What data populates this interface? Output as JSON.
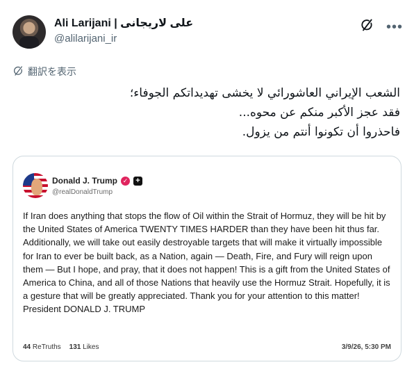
{
  "post": {
    "display_name": "Ali Larijani | علی لاریجانی",
    "handle": "@alilarijani_ir",
    "translate_label": "翻訳を表示",
    "text_lines": [
      "الشعب الإيراني العاشورائي لا يخشى تهديداتكم الجوفاء؛",
      "فقد عجز الأكبر منكم عن محوه...",
      "فاحذروا أن تكونوا أنتم من يزول."
    ]
  },
  "quoted": {
    "name": "Donald J. Trump",
    "handle": "@realDonaldTrump",
    "body": "If Iran does anything that stops the flow of Oil within the Strait of Hormuz, they will be hit by the United States of America TWENTY TIMES HARDER than they have been hit thus far. Additionally, we will take out easily destroyable targets that will make it virtually impossible for Iran to ever be built back, as a Nation, again — Death, Fire, and Fury will reign upon them — But I hope, and pray, that it does not happen! This is a gift from the United States of America to China, and all of those Nations that heavily use the Hormuz Strait. Hopefully, it is a gesture that will be greatly appreciated. Thank you for your attention to this matter! President DONALD J. TRUMP",
    "retruths_count": "44",
    "retruths_label": "ReTruths",
    "likes_count": "131",
    "likes_label": "Likes",
    "date": "3/9/26, 5:30 PM"
  },
  "icons": {
    "grok": "grok-icon",
    "more": "more-icon",
    "translate": "translate-icon",
    "verified": "verified-badge-icon",
    "plus": "plus-badge-icon"
  },
  "colors": {
    "secondary_text": "#536471",
    "border": "#cfd9de",
    "verified_badge": "#e0245e"
  }
}
